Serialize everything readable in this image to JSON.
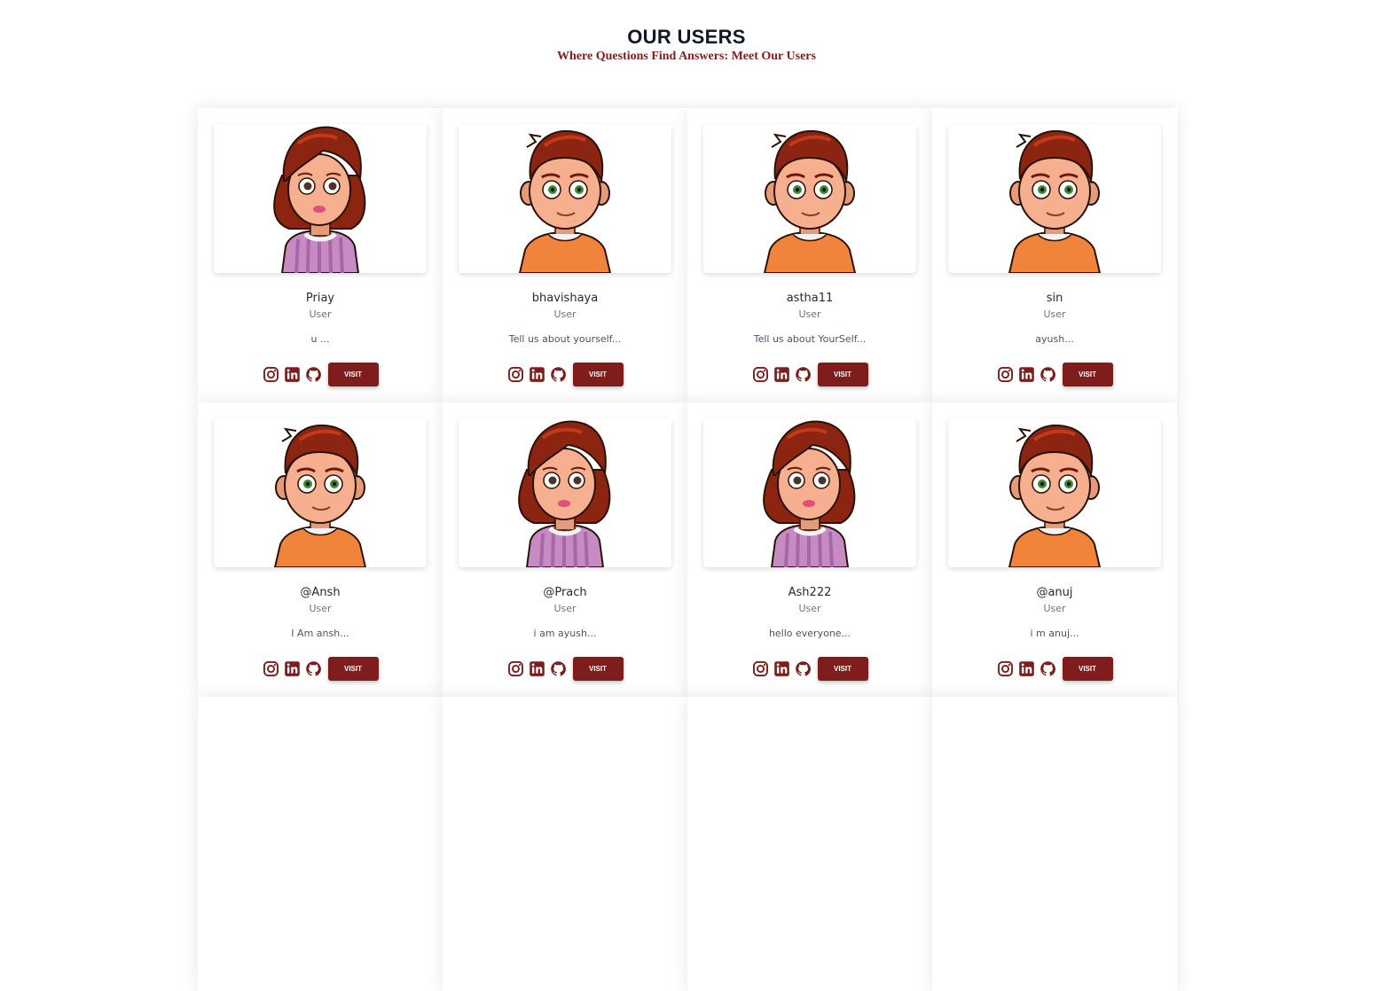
{
  "header": {
    "title": "OUR USERS",
    "subtitle": "Where Questions Find Answers: Meet Our Users"
  },
  "colors": {
    "accent": "#7f1d1d",
    "subtitle": "#8b1a1a"
  },
  "users": [
    {
      "name": "Priay",
      "role": "User",
      "bio": "u ...",
      "avatar": "girl-avatar",
      "visit_label": "VISIT"
    },
    {
      "name": "bhavishaya",
      "role": "User",
      "bio": "Tell us about yourself...",
      "avatar": "boy-avatar",
      "visit_label": "VISIT"
    },
    {
      "name": "astha11",
      "role": "User",
      "bio": "Tell us about YourSelf...",
      "avatar": "boy-avatar",
      "visit_label": "VISIT"
    },
    {
      "name": "sin",
      "role": "User",
      "bio": "ayush...",
      "avatar": "boy-avatar",
      "visit_label": "VISIT"
    },
    {
      "name": "@Ansh",
      "role": "User",
      "bio": "I Am ansh...",
      "avatar": "boy-avatar",
      "visit_label": "VISIT"
    },
    {
      "name": "@Prach",
      "role": "User",
      "bio": "i am ayush...",
      "avatar": "girl-avatar",
      "visit_label": "VISIT"
    },
    {
      "name": "Ash222",
      "role": "User",
      "bio": "hello everyone...",
      "avatar": "girl-avatar",
      "visit_label": "VISIT"
    },
    {
      "name": "@anuj",
      "role": "User",
      "bio": "i m anuj...",
      "avatar": "boy-avatar",
      "visit_label": "VISIT"
    }
  ]
}
